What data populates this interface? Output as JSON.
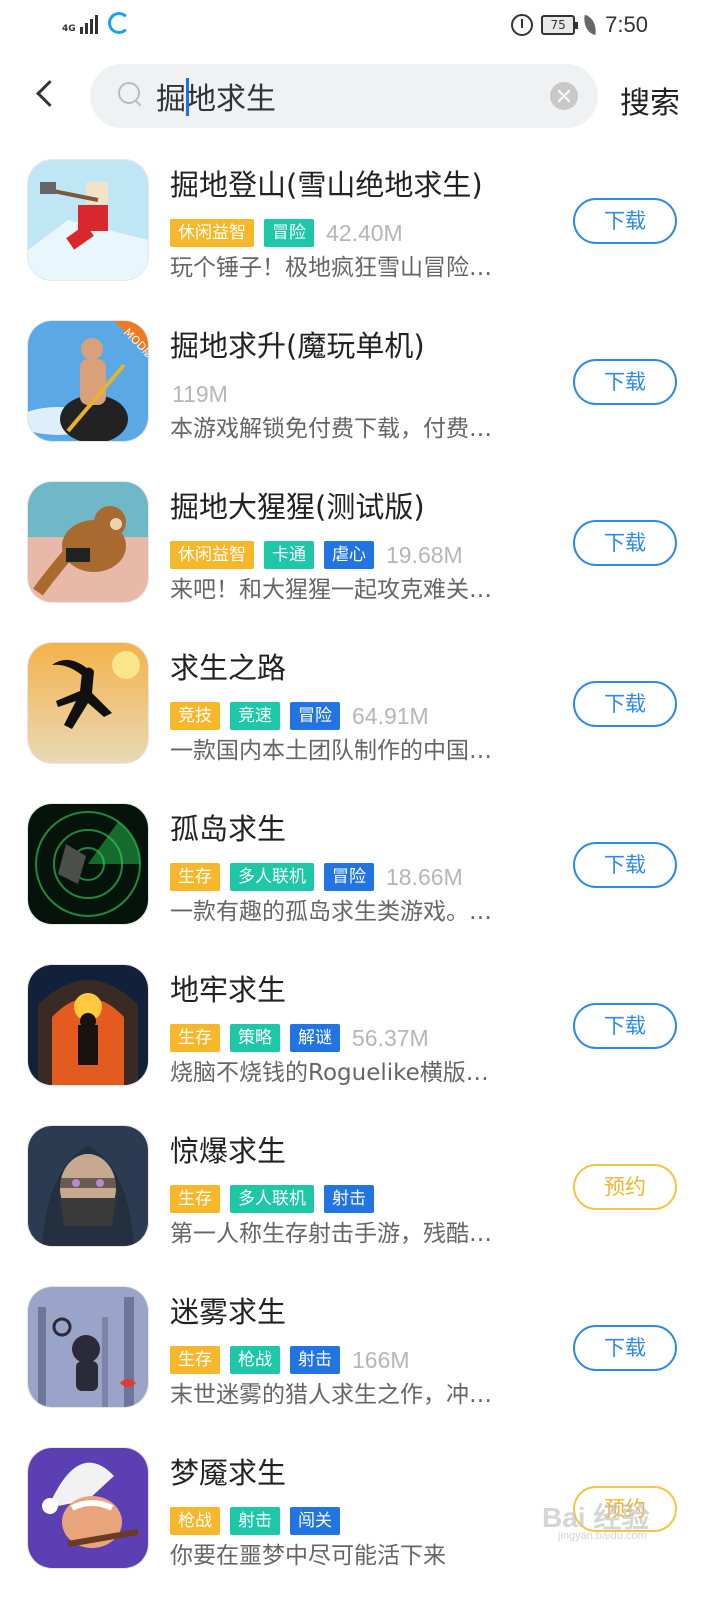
{
  "status_bar": {
    "network": "4G",
    "battery": "75",
    "time": "7:50"
  },
  "search": {
    "value": "掘地求生",
    "placeholder": "",
    "submit_label": "搜索"
  },
  "results": [
    {
      "name": "掘地登山(雪山绝地求生)",
      "tags": [
        {
          "text": "休闲益智",
          "color": "orange"
        },
        {
          "text": "冒险",
          "color": "teal"
        }
      ],
      "size": "42.40M",
      "desc": "玩个锤子！极地疯狂雪山冒险…",
      "action": "下载",
      "icon": "mountain-climber-icon"
    },
    {
      "name": "掘地求升(魔玩单机)",
      "tags": [],
      "size": "119M",
      "desc": "本游戏解锁免付费下载，付费…",
      "action": "下载",
      "icon": "man-in-pot-icon",
      "badge": "MOD版"
    },
    {
      "name": "掘地大猩猩(测试版)",
      "tags": [
        {
          "text": "休闲益智",
          "color": "orange"
        },
        {
          "text": "卡通",
          "color": "teal"
        },
        {
          "text": "虐心",
          "color": "blue"
        }
      ],
      "size": "19.68M",
      "desc": "来吧！和大猩猩一起攻克难关…",
      "action": "下载",
      "icon": "gorilla-icon"
    },
    {
      "name": "求生之路",
      "tags": [
        {
          "text": "竞技",
          "color": "orange"
        },
        {
          "text": "竞速",
          "color": "teal"
        },
        {
          "text": "冒险",
          "color": "blue"
        }
      ],
      "size": "64.91M",
      "desc": "一款国内本土团队制作的中国…",
      "action": "下载",
      "icon": "running-silhouette-icon"
    },
    {
      "name": "孤岛求生",
      "tags": [
        {
          "text": "生存",
          "color": "orange"
        },
        {
          "text": "多人联机",
          "color": "teal"
        },
        {
          "text": "冒险",
          "color": "blue"
        }
      ],
      "size": "18.66M",
      "desc": "一款有趣的孤岛求生类游戏。…",
      "action": "下载",
      "icon": "radar-icon"
    },
    {
      "name": "地牢求生",
      "tags": [
        {
          "text": "生存",
          "color": "orange"
        },
        {
          "text": "策略",
          "color": "teal"
        },
        {
          "text": "解谜",
          "color": "blue"
        }
      ],
      "size": "56.37M",
      "desc": "烧脑不烧钱的Roguelike横版…",
      "action": "下载",
      "icon": "dungeon-torch-icon"
    },
    {
      "name": "惊爆求生",
      "tags": [
        {
          "text": "生存",
          "color": "orange"
        },
        {
          "text": "多人联机",
          "color": "teal"
        },
        {
          "text": "射击",
          "color": "blue"
        }
      ],
      "size": "",
      "desc": "第一人称生存射击手游，残酷…",
      "action": "预约",
      "icon": "masked-soldier-icon"
    },
    {
      "name": "迷雾求生",
      "tags": [
        {
          "text": "生存",
          "color": "orange"
        },
        {
          "text": "枪战",
          "color": "teal"
        },
        {
          "text": "射击",
          "color": "blue"
        }
      ],
      "size": "166M",
      "desc": "末世迷雾的猎人求生之作，冲…",
      "action": "下载",
      "icon": "foggy-hunter-icon"
    },
    {
      "name": "梦魇求生",
      "tags": [
        {
          "text": "枪战",
          "color": "orange"
        },
        {
          "text": "射击",
          "color": "teal"
        },
        {
          "text": "闯关",
          "color": "blue"
        }
      ],
      "size": "",
      "desc": "你要在噩梦中尽可能活下来",
      "action": "预约",
      "icon": "gnome-wizard-icon"
    }
  ],
  "watermark": {
    "main": "Bai 经验",
    "sub": "jingyan.baidu.com"
  },
  "colors": {
    "accent_blue": "#2f8ae4",
    "reserve_yellow": "#f3c44a",
    "tag_orange": "#f6b82a",
    "tag_teal": "#1dc7a8",
    "tag_blue": "#2274e0"
  }
}
